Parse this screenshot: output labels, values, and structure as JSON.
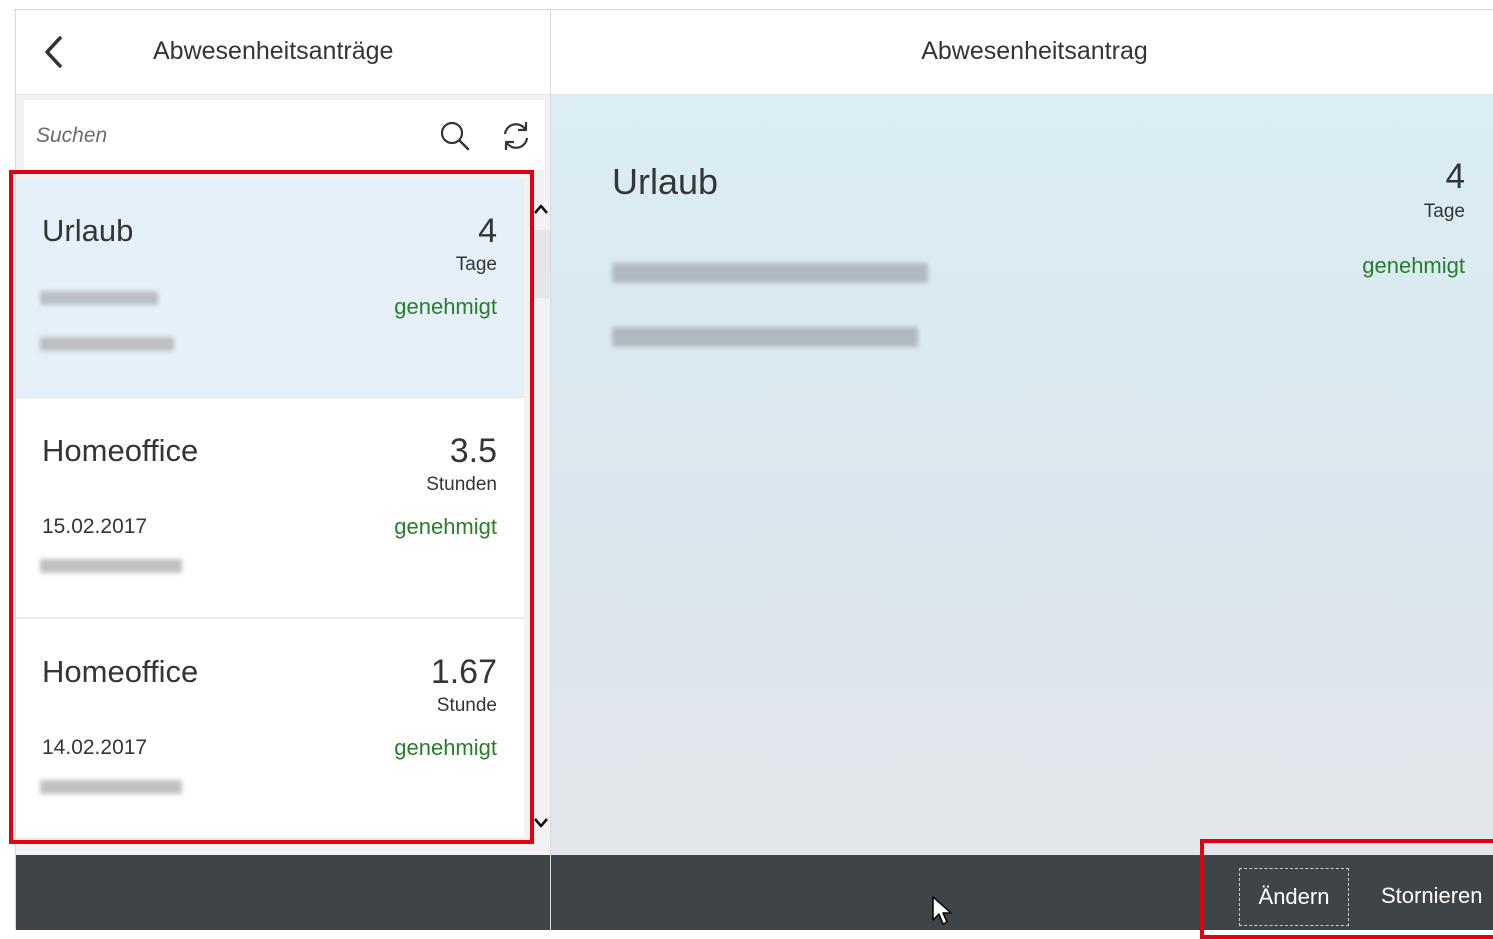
{
  "master": {
    "title": "Abwesenheitsanträge",
    "search": {
      "placeholder": "Suchen",
      "value": ""
    },
    "items": [
      {
        "title": "Urlaub",
        "number": "4",
        "unit": "Tage",
        "date": "",
        "status": "genehmigt",
        "selected": true
      },
      {
        "title": "Homeoffice",
        "number": "3.5",
        "unit": "Stunden",
        "date": "15.02.2017",
        "status": "genehmigt",
        "selected": false
      },
      {
        "title": "Homeoffice",
        "number": "1.67",
        "unit": "Stunde",
        "date": "14.02.2017",
        "status": "genehmigt",
        "selected": false
      }
    ]
  },
  "detail": {
    "header_title": "Abwesenheitsantrag",
    "object": {
      "title": "Urlaub",
      "number": "4",
      "unit": "Tage",
      "status": "genehmigt"
    }
  },
  "footer": {
    "edit_label": "Ändern",
    "cancel_label": "Stornieren"
  },
  "icons": {
    "back": "chevron-left-icon",
    "search": "search-icon",
    "refresh": "refresh-icon",
    "scroll_up": "chevron-up-icon",
    "scroll_down": "chevron-down-icon",
    "cursor": "mouse-pointer-icon"
  },
  "colors": {
    "status_positive": "#2b7d2b",
    "selected_item": "#e5f0f9",
    "footer": "#3f4449",
    "highlight": "#e3000f"
  }
}
